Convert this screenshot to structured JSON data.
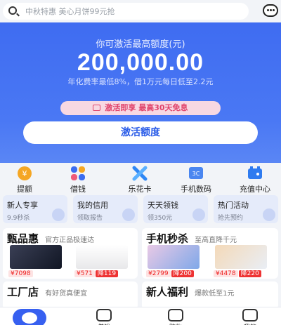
{
  "search": {
    "placeholder": "中秋特惠 美心月饼99元抢"
  },
  "banner": {
    "label": "你可激活最高额度(元)",
    "amount": "200,000.00",
    "rate_text": "年化费率最低8%，借1万元每日低至2.2元",
    "promo": "激活即享 最高30天免息",
    "button": "激活额度"
  },
  "quick_nav": [
    {
      "label": "提额",
      "icon": "yuan-coin-icon",
      "color": "#f5a623"
    },
    {
      "label": "借钱",
      "icon": "four-petal-icon",
      "color": "#3b6cf0"
    },
    {
      "label": "乐花卡",
      "icon": "x-flower-icon",
      "color": "#2f87f5"
    },
    {
      "label": "手机数码",
      "icon": "3c-icon",
      "color": "#4a86f0"
    },
    {
      "label": "充值中心",
      "icon": "wallet-icon",
      "color": "#2f7bf0"
    }
  ],
  "cards": [
    {
      "title": "新人专享",
      "sub": "9.9秒杀"
    },
    {
      "title": "我的信用",
      "sub": "领取报告"
    },
    {
      "title": "天天领钱",
      "sub": "领350元"
    },
    {
      "title": "热门活动",
      "sub": "抢先预约"
    }
  ],
  "panel_left": {
    "title": "甄品惠",
    "sub": "官方正品极速达",
    "products": [
      {
        "price": "¥7098",
        "discount": ""
      },
      {
        "price": "¥571",
        "discount": "降119"
      }
    ]
  },
  "panel_right": {
    "title": "手机秒杀",
    "sub": "至高直降千元",
    "products": [
      {
        "price": "¥2799",
        "discount": "降200"
      },
      {
        "price": "¥4478",
        "discount": "降220"
      }
    ]
  },
  "panel_bottom_left": {
    "title": "工厂店",
    "sub": "有好货真便宜"
  },
  "panel_bottom_right": {
    "title": "新人福利",
    "sub": "爆款低至1元"
  },
  "bottom_nav": [
    {
      "label": "借钱"
    },
    {
      "label": "购物"
    },
    {
      "label": "我的"
    }
  ]
}
